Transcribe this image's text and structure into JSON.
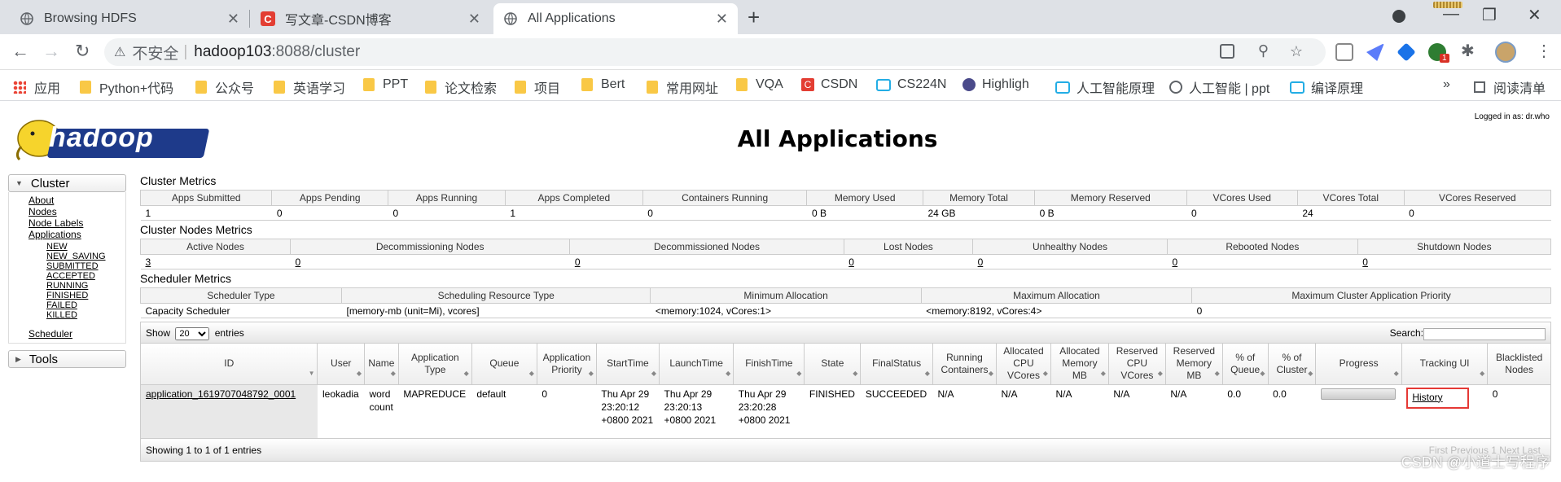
{
  "tabs": [
    {
      "title": "Browsing HDFS",
      "icon": "globe-icon"
    },
    {
      "title": "写文章-CSDN博客",
      "icon": "csdn-icon"
    },
    {
      "title": "All Applications",
      "icon": "globe-icon"
    }
  ],
  "address": {
    "insecure": "不安全",
    "host": "hadoop103",
    "path": ":8088/cluster"
  },
  "bookmarks": [
    "应用",
    "Python+代码",
    "公众号",
    "英语学习",
    "PPT",
    "论文检索",
    "项目",
    "Bert",
    "常用网址",
    "VQA",
    "CSDN",
    "CS224N",
    "Highligh",
    "人工智能原理",
    "人工智能 | ppt",
    "编译原理",
    "阅读清单"
  ],
  "ext_badge": "1",
  "page": {
    "title": "All Applications",
    "logged_in": "Logged in as: dr.who",
    "logo_text": "hadoop"
  },
  "sidebar": {
    "cluster_label": "Cluster",
    "links": [
      "About",
      "Nodes",
      "Node Labels",
      "Applications"
    ],
    "states": [
      "NEW",
      "NEW_SAVING",
      "SUBMITTED",
      "ACCEPTED",
      "RUNNING",
      "FINISHED",
      "FAILED",
      "KILLED"
    ],
    "scheduler": "Scheduler",
    "tools_label": "Tools"
  },
  "cluster_metrics": {
    "title": "Cluster Metrics",
    "headers": [
      "Apps Submitted",
      "Apps Pending",
      "Apps Running",
      "Apps Completed",
      "Containers Running",
      "Memory Used",
      "Memory Total",
      "Memory Reserved",
      "VCores Used",
      "VCores Total",
      "VCores Reserved"
    ],
    "values": [
      "1",
      "0",
      "0",
      "1",
      "0",
      "0 B",
      "24 GB",
      "0 B",
      "0",
      "24",
      "0"
    ]
  },
  "nodes_metrics": {
    "title": "Cluster Nodes Metrics",
    "headers": [
      "Active Nodes",
      "Decommissioning Nodes",
      "Decommissioned Nodes",
      "Lost Nodes",
      "Unhealthy Nodes",
      "Rebooted Nodes",
      "Shutdown Nodes"
    ],
    "values": [
      "3",
      "0",
      "0",
      "0",
      "0",
      "0",
      "0"
    ]
  },
  "scheduler_metrics": {
    "title": "Scheduler Metrics",
    "headers": [
      "Scheduler Type",
      "Scheduling Resource Type",
      "Minimum Allocation",
      "Maximum Allocation",
      "Maximum Cluster Application Priority"
    ],
    "values": [
      "Capacity Scheduler",
      "[memory-mb (unit=Mi), vcores]",
      "<memory:1024, vCores:1>",
      "<memory:8192, vCores:4>",
      "0"
    ]
  },
  "apps_table": {
    "show_label": "Show",
    "show_value": "20",
    "entries_label": "entries",
    "search_label": "Search:",
    "headers": [
      "ID",
      "User",
      "Name",
      "Application Type",
      "Queue",
      "Application Priority",
      "StartTime",
      "LaunchTime",
      "FinishTime",
      "State",
      "FinalStatus",
      "Running Containers",
      "Allocated CPU VCores",
      "Allocated Memory MB",
      "Reserved CPU VCores",
      "Reserved Memory MB",
      "% of Queue",
      "% of Cluster",
      "Progress",
      "Tracking UI",
      "Blacklisted Nodes"
    ],
    "row": {
      "id": "application_1619707048792_0001",
      "user": "leokadia",
      "name": "word count",
      "type": "MAPREDUCE",
      "queue": "default",
      "priority": "0",
      "start": "Thu Apr 29 23:20:12 +0800 2021",
      "launch": "Thu Apr 29 23:20:13 +0800 2021",
      "finish": "Thu Apr 29 23:20:28 +0800 2021",
      "state": "FINISHED",
      "final": "SUCCEEDED",
      "running": "N/A",
      "acpu": "N/A",
      "amem": "N/A",
      "rcpu": "N/A",
      "rmem": "N/A",
      "pqueue": "0.0",
      "pcluster": "0.0",
      "progress": 1.0,
      "tracking": "History",
      "blacklisted": "0"
    },
    "footer": "Showing 1 to 1 of 1 entries",
    "footer_right": "First Previous 1 Next Last"
  },
  "watermark": "CSDN @小道士写程序"
}
